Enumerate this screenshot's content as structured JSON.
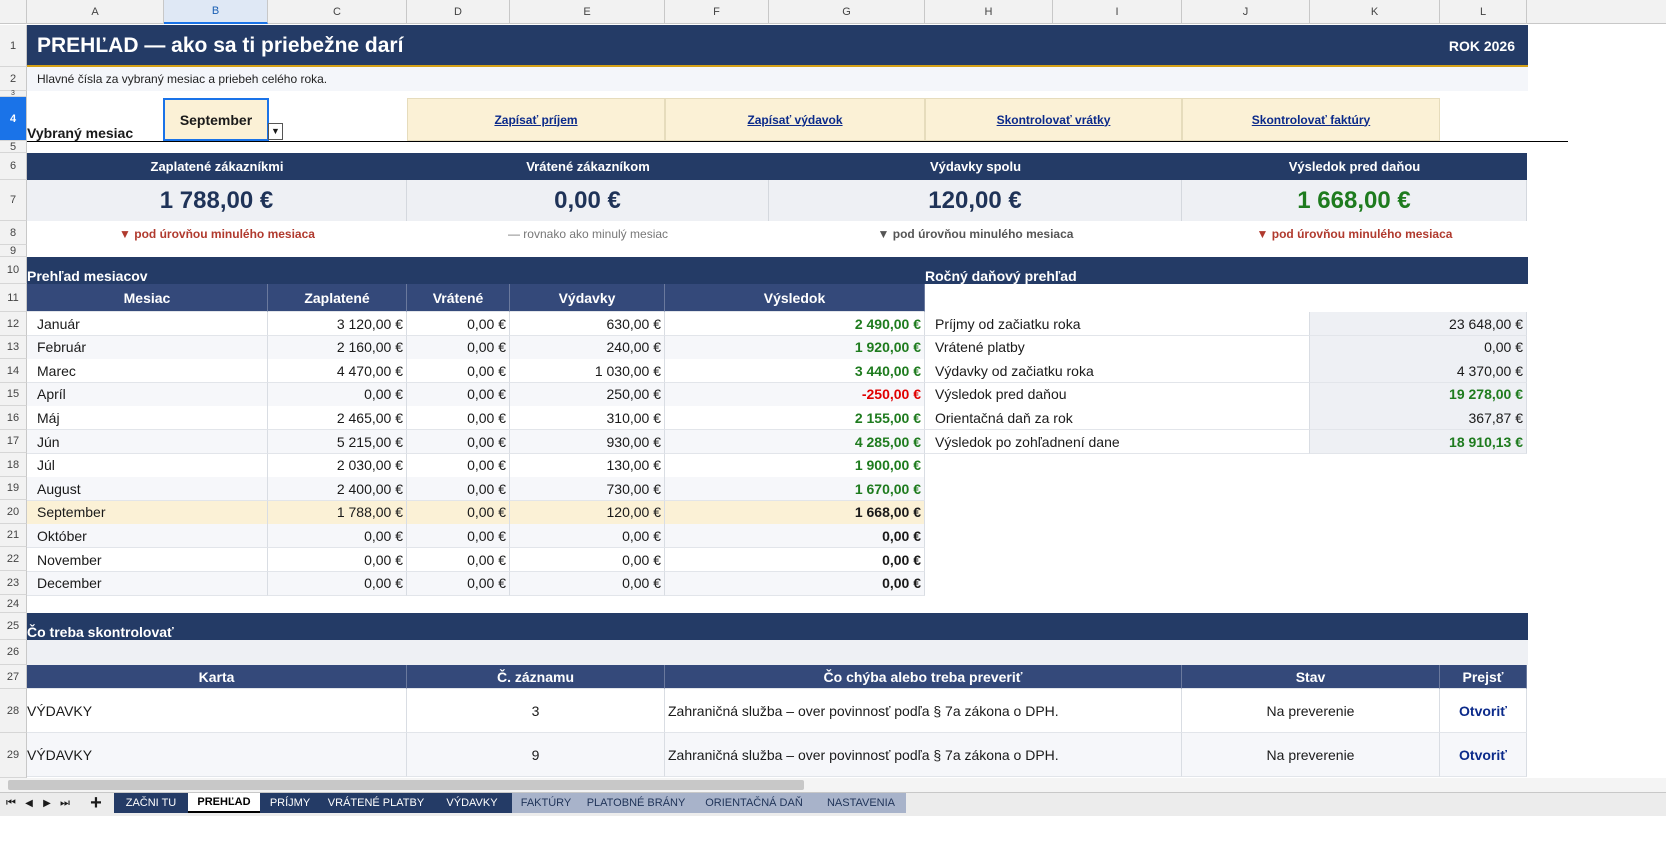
{
  "columns": [
    "A",
    "B",
    "C",
    "D",
    "E",
    "F",
    "G",
    "H",
    "I",
    "J",
    "K",
    "L"
  ],
  "rows": [
    "1",
    "2",
    "3",
    "4",
    "5",
    "6",
    "7",
    "8",
    "9",
    "10",
    "11",
    "12",
    "13",
    "14",
    "15",
    "16",
    "17",
    "18",
    "19",
    "20",
    "21",
    "22",
    "23",
    "24",
    "25",
    "26",
    "27",
    "28",
    "29"
  ],
  "header": {
    "title": "PREHĽAD — ako sa ti priebežne darí",
    "year": "ROK 2026",
    "subtitle": "Hlavné čísla za vybraný mesiac a priebeh celého roka."
  },
  "selector": {
    "label": "Vybraný mesiac",
    "value": "September"
  },
  "actions": [
    "Zapísať príjem",
    "Zapísať výdavok",
    "Skontrolovať vrátky",
    "Skontrolovať faktúry"
  ],
  "kpis": [
    {
      "label": "Zaplatené zákazníkmi",
      "value": "1 788,00 €",
      "note": "▼ pod úrovňou minulého mesiaca",
      "note_color": "#b03a2e"
    },
    {
      "label": "Vrátené zákazníkom",
      "value": "0,00 €",
      "note": "— rovnako ako minulý mesiac",
      "note_color": "#777777"
    },
    {
      "label": "Výdavky spolu",
      "value": "120,00 €",
      "note": "▼ pod úrovňou minulého mesiaca",
      "note_color": "#555555"
    },
    {
      "label": "Výsledok pred daňou",
      "value": "1 668,00 €",
      "note": "▼ pod úrovňou minulého mesiaca",
      "note_color": "#b03a2e"
    }
  ],
  "monthly": {
    "title": "Prehľad mesiacov",
    "headers": [
      "Mesiac",
      "Zaplatené",
      "Vrátené",
      "Výdavky",
      "Výsledok"
    ],
    "rows": [
      [
        "Január",
        "3 120,00 €",
        "0,00 €",
        "630,00 €",
        "2 490,00 €"
      ],
      [
        "Február",
        "2 160,00 €",
        "0,00 €",
        "240,00 €",
        "1 920,00 €"
      ],
      [
        "Marec",
        "4 470,00 €",
        "0,00 €",
        "1 030,00 €",
        "3 440,00 €"
      ],
      [
        "Apríl",
        "0,00 €",
        "0,00 €",
        "250,00 €",
        "-250,00 €"
      ],
      [
        "Máj",
        "2 465,00 €",
        "0,00 €",
        "310,00 €",
        "2 155,00 €"
      ],
      [
        "Jún",
        "5 215,00 €",
        "0,00 €",
        "930,00 €",
        "4 285,00 €"
      ],
      [
        "Júl",
        "2 030,00 €",
        "0,00 €",
        "130,00 €",
        "1 900,00 €"
      ],
      [
        "August",
        "2 400,00 €",
        "0,00 €",
        "730,00 €",
        "1 670,00 €"
      ],
      [
        "September",
        "1 788,00 €",
        "0,00 €",
        "120,00 €",
        "1 668,00 €"
      ],
      [
        "Október",
        "0,00 €",
        "0,00 €",
        "0,00 €",
        "0,00 €"
      ],
      [
        "November",
        "0,00 €",
        "0,00 €",
        "0,00 €",
        "0,00 €"
      ],
      [
        "December",
        "0,00 €",
        "0,00 €",
        "0,00 €",
        "0,00 €"
      ]
    ],
    "result_styles": [
      "green",
      "green",
      "green",
      "red",
      "green",
      "green",
      "green",
      "green",
      "bold",
      "bold",
      "bold",
      "bold"
    ],
    "selected_index": 8
  },
  "annual": {
    "title": "Ročný daňový prehľad",
    "rows": [
      {
        "label": "Príjmy od začiatku roka",
        "value": "23 648,00 €",
        "style": ""
      },
      {
        "label": "Vrátené platby",
        "value": "0,00 €",
        "style": ""
      },
      {
        "label": "Výdavky od začiatku roka",
        "value": "4 370,00 €",
        "style": ""
      },
      {
        "label": "Výsledok pred daňou",
        "value": "19 278,00 €",
        "style": "green"
      },
      {
        "label": "Orientačná daň za rok",
        "value": "367,87 €",
        "style": ""
      },
      {
        "label": "Výsledok po zohľadnení dane",
        "value": "18 910,13 €",
        "style": "green"
      }
    ]
  },
  "checks": {
    "title": "Čo treba skontrolovať",
    "headers": [
      "Karta",
      "Č. záznamu",
      "Čo chýba alebo treba preveriť",
      "Stav",
      "Prejsť"
    ],
    "rows": [
      [
        "VÝDAVKY",
        "3",
        "Zahraničná služba – over povinnosť podľa § 7a zákona o DPH.",
        "Na preverenie",
        "Otvoriť"
      ],
      [
        "VÝDAVKY",
        "9",
        "Zahraničná služba – over povinnosť podľa § 7a zákona o DPH.",
        "Na preverenie",
        "Otvoriť"
      ]
    ]
  },
  "sheet_tabs": [
    {
      "label": "ZAČNI TU",
      "bg": "#243b66",
      "fg": "#ffffff"
    },
    {
      "label": "PREHĽAD",
      "bg": "#ffffff",
      "fg": "#000000"
    },
    {
      "label": "PRÍJMY",
      "bg": "#243b66",
      "fg": "#ffffff"
    },
    {
      "label": "VRÁTENÉ PLATBY",
      "bg": "#243b66",
      "fg": "#ffffff"
    },
    {
      "label": "VÝDAVKY",
      "bg": "#243b66",
      "fg": "#ffffff"
    },
    {
      "label": "FAKTÚRY",
      "bg": "#a8b3ca",
      "fg": "#1f3358"
    },
    {
      "label": "PLATOBNÉ BRÁNY",
      "bg": "#a8b3ca",
      "fg": "#1f3358"
    },
    {
      "label": "ORIENTAČNÁ DAŇ",
      "bg": "#a8b3ca",
      "fg": "#1f3358"
    },
    {
      "label": "NASTAVENIA",
      "bg": "#a8b3ca",
      "fg": "#1f3358"
    }
  ],
  "colors": {
    "navy": "#243b66",
    "header_blue": "#34497a",
    "highlight": "#fbf1d6",
    "green": "#1e7b1e",
    "red": "#e00000",
    "gold": "#d4a017"
  }
}
